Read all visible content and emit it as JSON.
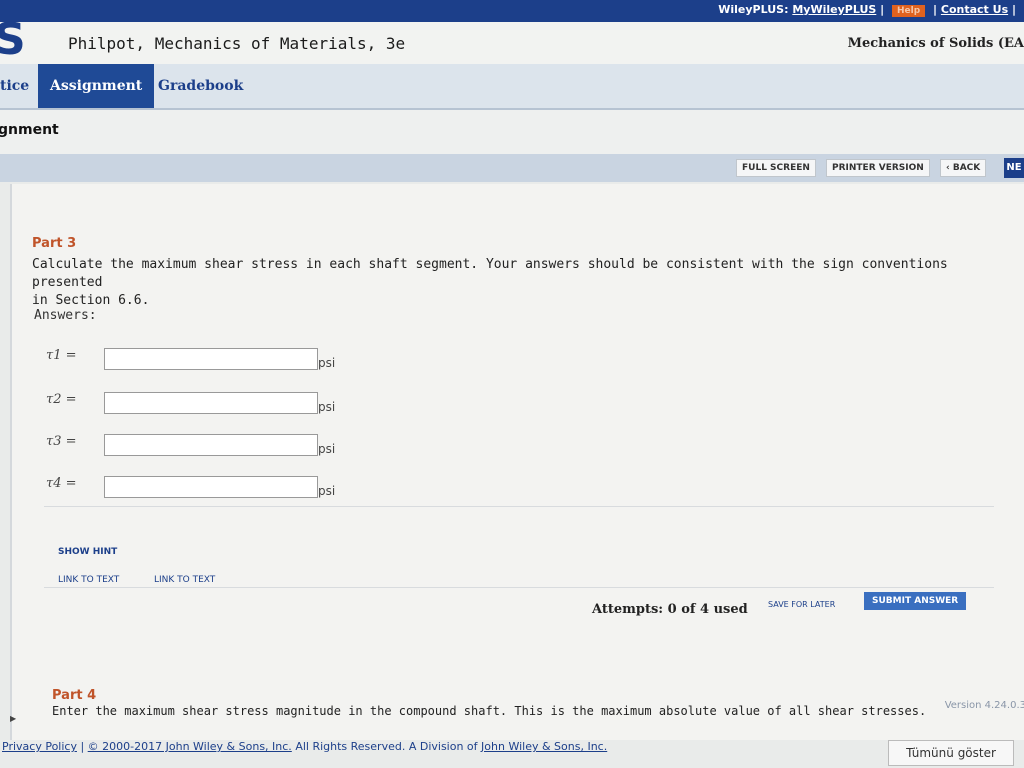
{
  "topbar": {
    "wileyplus": "WileyPLUS:",
    "mywileyplus": "MyWileyPLUS",
    "help": "Help",
    "contact": "Contact Us"
  },
  "header": {
    "book_title": "Philpot, Mechanics of Materials, 3e",
    "course": "Mechanics of Solids (EA"
  },
  "tabs": [
    {
      "label": "tice"
    },
    {
      "label": "Assignment"
    },
    {
      "label": "Gradebook"
    }
  ],
  "subheader": "gnment",
  "toolbar": {
    "full_screen": "FULL SCREEN",
    "printer_version": "PRINTER VERSION",
    "back": "‹ BACK",
    "next": "NE"
  },
  "part3": {
    "title": "Part 3",
    "question_line1": "Calculate the maximum shear stress in each shaft segment.  Your answers should be consistent with the sign conventions presented",
    "question_line2": "in Section 6.6.",
    "answers_label": "Answers:",
    "fields": [
      {
        "label": "τ1 =",
        "value": "",
        "unit": "psi"
      },
      {
        "label": "τ2 =",
        "value": "",
        "unit": "psi"
      },
      {
        "label": "τ3 =",
        "value": "",
        "unit": "psi"
      },
      {
        "label": "τ4 =",
        "value": "",
        "unit": "psi"
      }
    ],
    "show_hint": "SHOW HINT",
    "link_to_text_1": "LINK TO TEXT",
    "link_to_text_2": "LINK TO TEXT",
    "attempts": "Attempts: 0 of 4 used",
    "save_for_later": "SAVE FOR LATER",
    "submit_answer": "SUBMIT ANSWER"
  },
  "part4": {
    "title": "Part 4",
    "question": "Enter the maximum shear stress magnitude in the compound shaft.  This is the maximum absolute value of all shear stresses."
  },
  "version": "Version 4.24.0.3",
  "footer": {
    "privacy": "Privacy Policy",
    "copyright": "© 2000-2017 John Wiley & Sons, Inc.",
    "rights": " All Rights Reserved. A Division of ",
    "wiley_link": "John Wiley & Sons, Inc."
  },
  "browser_bar": {
    "show_all": "Tümünü göster"
  },
  "colors": {
    "brand_blue": "#1c3f8a",
    "part_orange": "#c0542a",
    "submit_blue": "#3a6fc0"
  }
}
